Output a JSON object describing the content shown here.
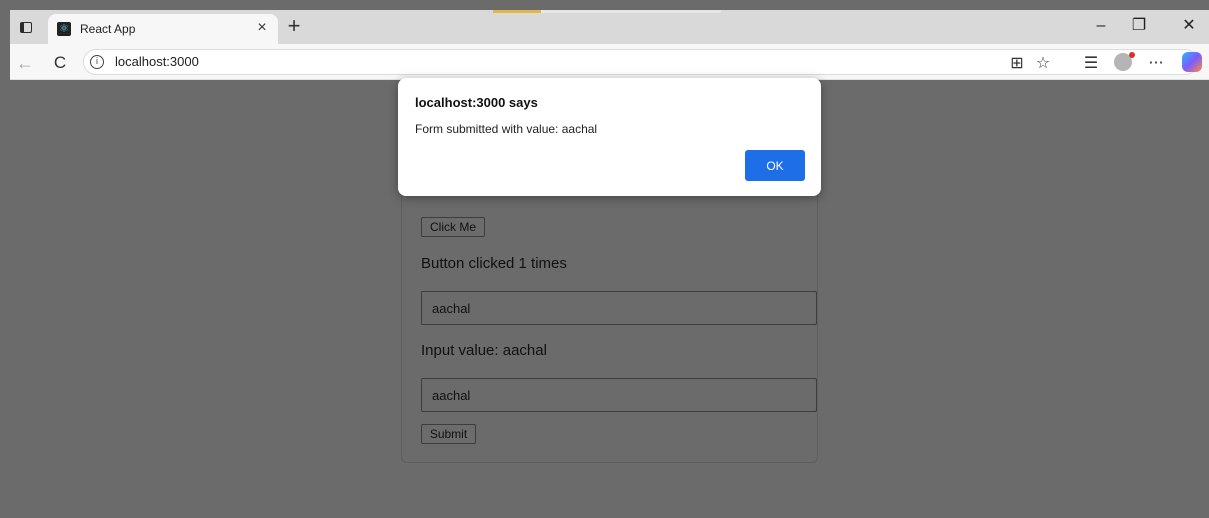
{
  "browser": {
    "tab_title": "React App",
    "tab_close": "×",
    "new_tab": "+",
    "url": "localhost:3000",
    "controls": {
      "minimize": "–",
      "restore": "❐",
      "close": "✕"
    },
    "icons": {
      "back": "←",
      "refresh": "C",
      "info": "i",
      "split": "⊞",
      "favorite": "☆",
      "collections": "☰",
      "more": "···"
    }
  },
  "page": {
    "click_button": "Click Me",
    "count_text": "Button clicked 1 times",
    "input_value": "aachal",
    "value_text": "Input value: aachal",
    "form_input_value": "aachal",
    "submit_button": "Submit"
  },
  "dialog": {
    "title": "localhost:3000 says",
    "message": "Form submitted with value: aachal",
    "ok_label": "OK"
  },
  "colors": {
    "accent": "#1e6ee8",
    "overlay": "#6b6b6b"
  }
}
